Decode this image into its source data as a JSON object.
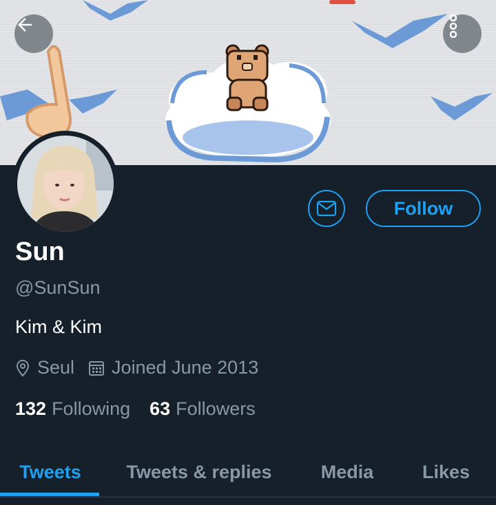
{
  "banner": {
    "back_icon": "arrow-left-icon",
    "more_icon": "more-vertical-icon"
  },
  "profile": {
    "name": "Sun",
    "handle": "@SunSun",
    "bio": "Kim & Kim",
    "location": "Seul",
    "joined": "Joined June 2013",
    "following_count": "132",
    "following_label": "Following",
    "followers_count": "63",
    "followers_label": "Followers"
  },
  "actions": {
    "message_icon": "envelope-icon",
    "follow_label": "Follow"
  },
  "tabs": [
    {
      "label": "Tweets",
      "active": true
    },
    {
      "label": "Tweets & replies",
      "active": false
    },
    {
      "label": "Media",
      "active": false
    },
    {
      "label": "Likes",
      "active": false
    }
  ],
  "colors": {
    "background": "#15202b",
    "accent": "#1da1f2",
    "secondary_text": "#8899a6",
    "primary_text": "#ffffff"
  }
}
